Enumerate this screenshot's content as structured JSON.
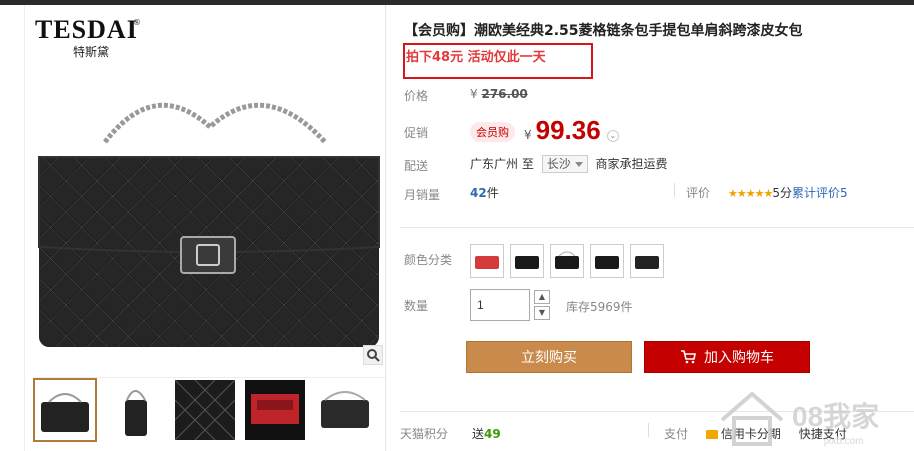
{
  "brand": {
    "logo_text": "TESDAI",
    "logo_sub": "特斯黛",
    "registered": "®"
  },
  "product": {
    "title": "【会员购】潮欧美经典2.55菱格链条包手提包单肩斜跨漆皮女包",
    "promo": "拍下48元 活动仅此一天"
  },
  "price": {
    "label": "价格",
    "currency": "¥",
    "original": "276.00",
    "promo_label": "促销",
    "badge": "会员购",
    "current": "99.36"
  },
  "shipping": {
    "label": "配送",
    "from": "广东广州",
    "to_word": "至",
    "to_city": "长沙",
    "note": "商家承担运费"
  },
  "sales": {
    "label": "月销量",
    "count": "42",
    "unit": "件",
    "rating_label": "评价",
    "stars": "★★★★★",
    "score": "5分",
    "review_link": "累计评价5"
  },
  "color": {
    "label": "颜色分类"
  },
  "quantity": {
    "label": "数量",
    "value": "1",
    "stock": "库存5969件"
  },
  "actions": {
    "buy_now": "立刻购买",
    "add_cart": "加入购物车"
  },
  "footer": {
    "points_label": "天猫积分",
    "points_value_prefix": "送",
    "points_value": "49",
    "pay_label": "支付",
    "pay_opt1": "信用卡分期",
    "pay_opt2": "快捷支付"
  },
  "watermark": {
    "text": "08我家",
    "sub": "jxxb.com"
  },
  "colors": {
    "price_red": "#c40000",
    "promo_red": "#e4393c",
    "buy_brown": "#c98a4b",
    "cart_red": "#c40000"
  }
}
